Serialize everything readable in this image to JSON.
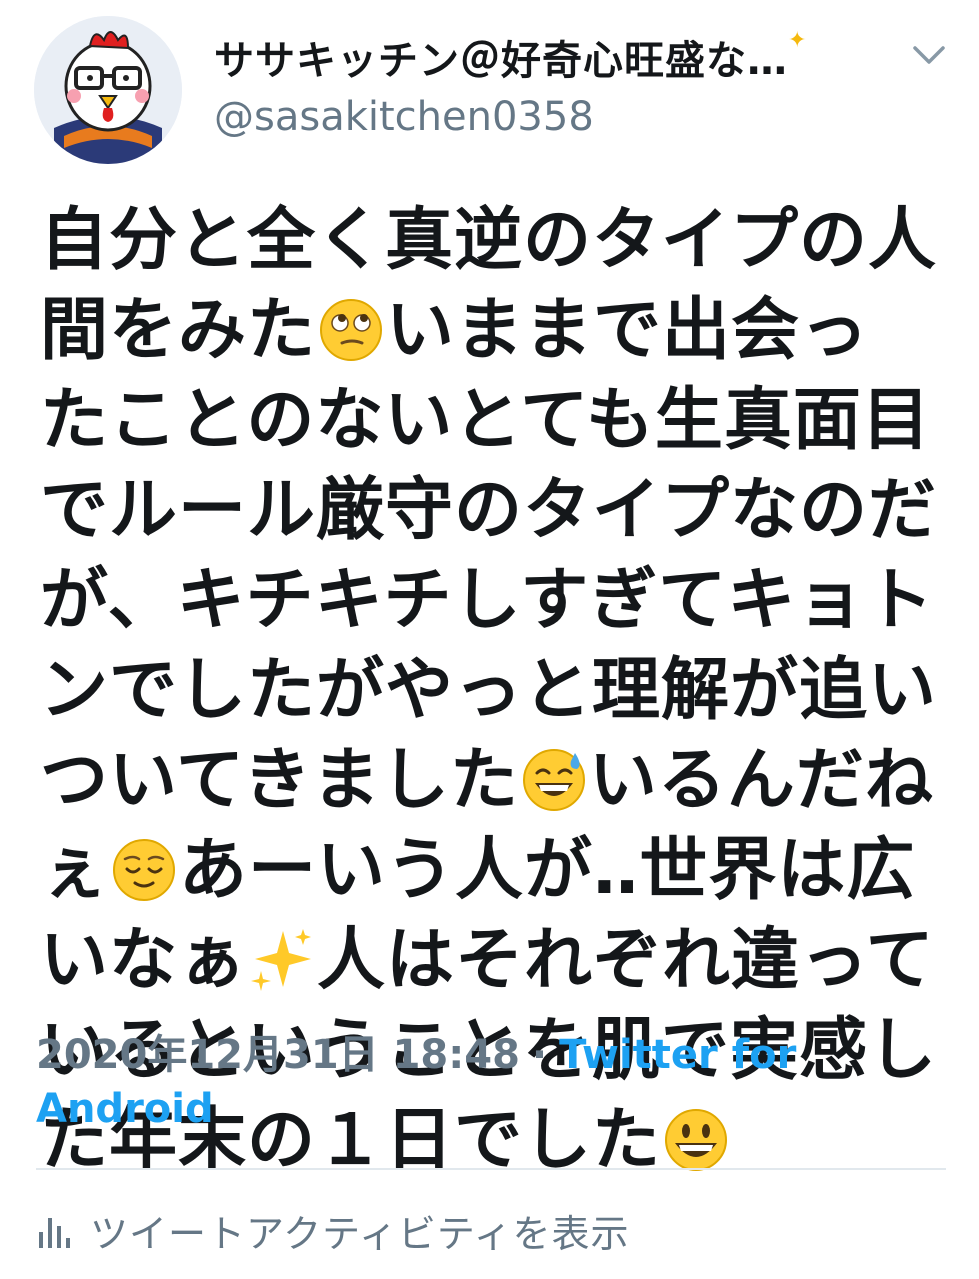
{
  "user": {
    "display_name": "ササキッチン＠好奇心旺盛な…",
    "handle": "@sasakitchen0358"
  },
  "icons": {
    "more": "chevron-down-icon",
    "activity": "bar-chart-icon"
  },
  "tweet": {
    "lines": [
      {
        "a": "自分と全く真逆のタイプの人"
      },
      {
        "a": "間をみた",
        "emoji": "face-with-rolling-eyes",
        "b": "いままで出会っ"
      },
      {
        "a": "たことのないとても生真面目"
      },
      {
        "a": "でルール厳守のタイプなのだ"
      },
      {
        "a": "が、キチキチしすぎてキョト"
      },
      {
        "a": "ンでしたがやっと理解が追い"
      },
      {
        "a": "ついてきました",
        "emoji": "grinning-face-with-sweat",
        "b": "いるんだね"
      },
      {
        "a": "ぇ",
        "emoji": "relieved-face",
        "b": "あーいう人が‥世界は広"
      },
      {
        "a": "いなぁ",
        "emoji": "sparkles",
        "b": "人はそれぞれ違って"
      },
      {
        "a": "いるということを肌で実感し"
      },
      {
        "a": "た年末の１日でした",
        "emoji": "grinning-face"
      }
    ]
  },
  "meta": {
    "timestamp": "2020年12月31日 18:48",
    "separator": "·",
    "source": "Twitter for Android"
  },
  "activity": {
    "label": "ツイートアクティビティを表示"
  },
  "colors": {
    "text": "#14171a",
    "secondary": "#657786",
    "link": "#1da1f2",
    "divider": "#e1e8ed"
  }
}
